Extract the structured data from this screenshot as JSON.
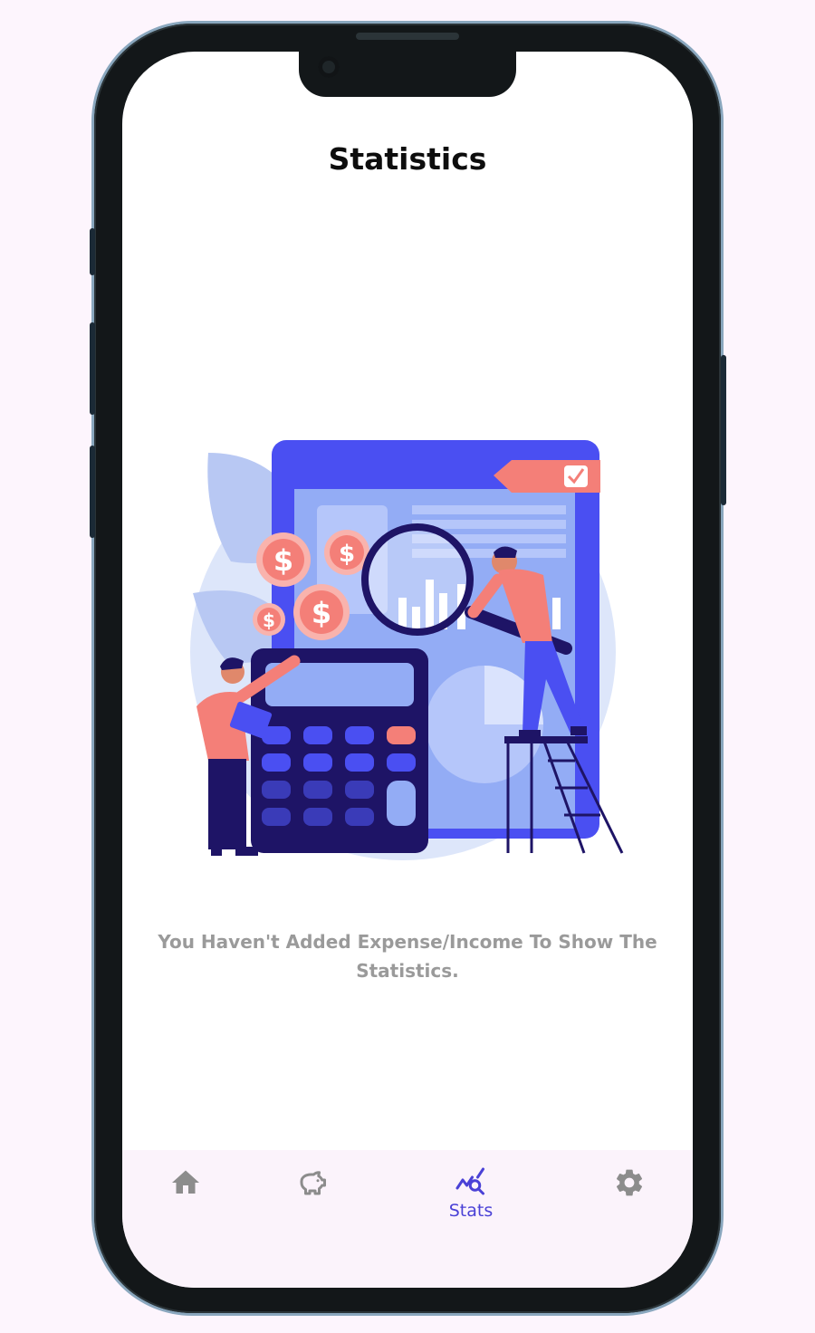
{
  "page": {
    "title": "Statistics"
  },
  "empty_state": {
    "message": "You Haven't Added Expense/Income To Show The Statistics."
  },
  "bottom_nav": {
    "items": [
      {
        "icon": "home-icon",
        "label": ""
      },
      {
        "icon": "piggy-bank-icon",
        "label": ""
      },
      {
        "icon": "stats-icon",
        "label": "Stats",
        "active": true
      },
      {
        "icon": "gear-icon",
        "label": ""
      }
    ]
  },
  "colors": {
    "accent": "#4a41d6",
    "inactive_icon": "#8c8c8c",
    "nav_background": "#fbf3fb",
    "message_text": "#9a9a9a"
  }
}
